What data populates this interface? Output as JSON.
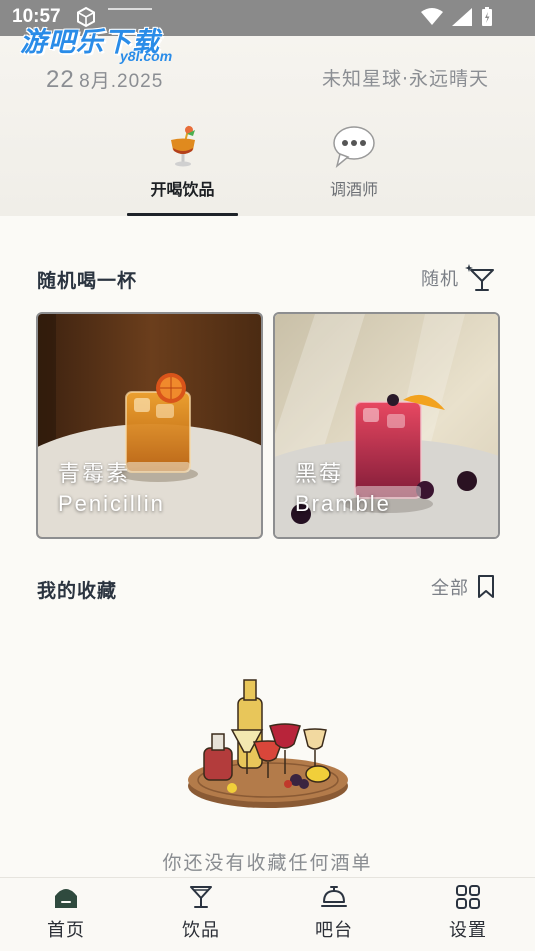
{
  "status_bar": {
    "time": "10:57"
  },
  "watermark": {
    "main": "游吧乐下载",
    "sub": "y8l.com"
  },
  "header": {
    "date_day": "22",
    "date_month": "8月.2025",
    "slogan": "未知星球·永远晴天"
  },
  "tabs": [
    {
      "label": "开喝饮品",
      "icon": "cocktail-glass-icon",
      "active": true
    },
    {
      "label": "调酒师",
      "icon": "speech-bubble-icon",
      "active": false
    }
  ],
  "random_section": {
    "title": "随机喝一杯",
    "action_label": "随机",
    "action_icon": "sparkle-cocktail-icon",
    "cards": [
      {
        "name_cn": "青霉素",
        "name_en": "Penicillin"
      },
      {
        "name_cn": "黑莓",
        "name_en": "Bramble"
      }
    ]
  },
  "favorites_section": {
    "title": "我的收藏",
    "action_label": "全部",
    "action_icon": "bookmark-icon",
    "empty_text": "你还没有收藏任何酒单"
  },
  "bottom_nav": [
    {
      "label": "首页",
      "icon": "home-icon"
    },
    {
      "label": "饮品",
      "icon": "martini-glass-icon"
    },
    {
      "label": "吧台",
      "icon": "bar-counter-bell-icon"
    },
    {
      "label": "设置",
      "icon": "grid-settings-icon"
    }
  ],
  "colors": {
    "accent": "#2b3440",
    "background": "#fbfaf6",
    "home_icon": "#2f4a3e"
  }
}
